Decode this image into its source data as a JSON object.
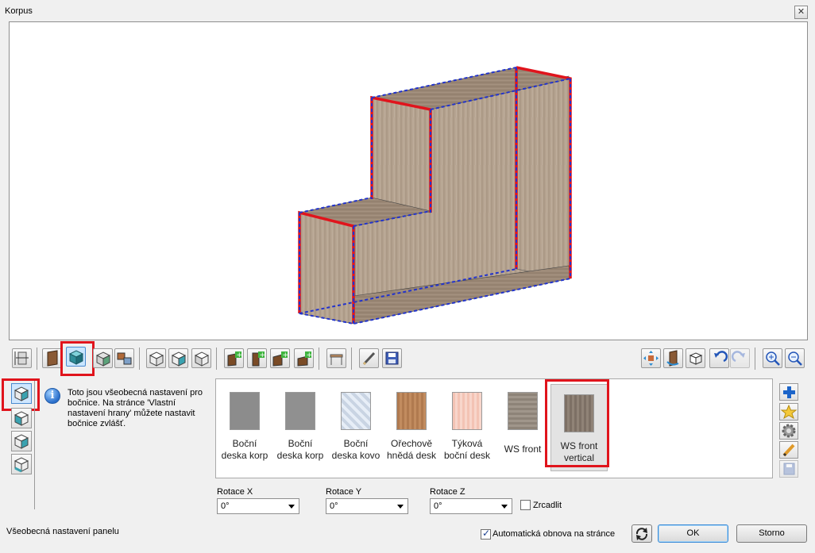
{
  "window": {
    "title": "Korpus",
    "close_glyph": "✕"
  },
  "info": {
    "icon": "info-icon",
    "text": "Toto jsou všeobecná nastavení pro bočnice. Na stránce 'Vlastní nastavení hrany' můžete nastavit bočnice zvlášť."
  },
  "materials": [
    {
      "label_line1": "Boční",
      "label_line2": "deska korp",
      "color": "#8c8c8c"
    },
    {
      "label_line1": "Boční",
      "label_line2": "deska korp",
      "color": "#8f8f8f"
    },
    {
      "label_line1": "Boční",
      "label_line2": "deska kovo",
      "color": "#c9d4e3"
    },
    {
      "label_line1": "Ořechově",
      "label_line2": "hnědá desk",
      "color": "#b07a4f"
    },
    {
      "label_line1": "Týková",
      "label_line2": "boční desk",
      "color": "#f3c3b4"
    },
    {
      "label_line1": "WS front",
      "label_line2": "",
      "color": "#8d8378"
    },
    {
      "label_line1": "WS front",
      "label_line2": "vertical",
      "color": "#7d7065"
    }
  ],
  "rotation": {
    "x_label": "Rotace X",
    "x_value": "0°",
    "y_label": "Rotace Y",
    "y_value": "0°",
    "z_label": "Rotace Z",
    "z_value": "0°",
    "mirror_label": "Zrcadlit"
  },
  "status": {
    "panel_text": "Všeobecná nastavení panelu"
  },
  "auto_refresh_label": "Automatická obnova na stránce",
  "buttons": {
    "ok": "OK",
    "cancel": "Storno"
  },
  "colors": {
    "highlight": "#e0141c",
    "wood": "#b6a592",
    "edge_blue": "#2233cc"
  }
}
